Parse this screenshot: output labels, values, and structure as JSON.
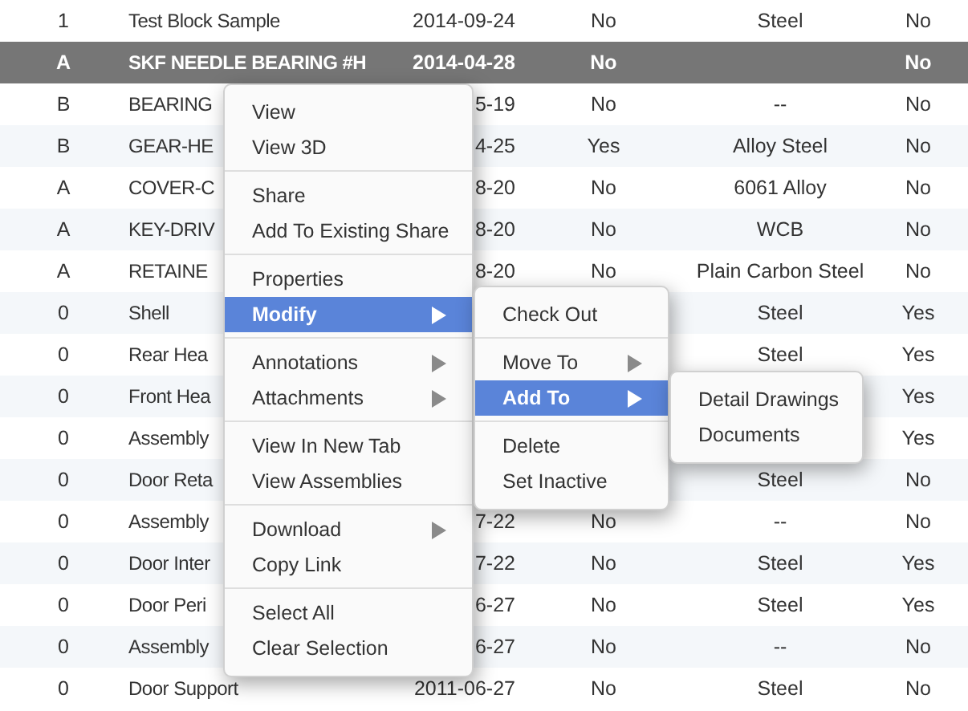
{
  "table": {
    "rows": [
      {
        "selected": false,
        "cells": [
          "1",
          "Test Block Sample",
          "2014-09-24",
          "No",
          "Steel",
          "No"
        ]
      },
      {
        "selected": true,
        "cells": [
          "A",
          "SKF NEEDLE BEARING #H",
          "2014-04-28",
          "No",
          null,
          "No"
        ]
      },
      {
        "selected": false,
        "cells": [
          "B",
          "BEARING",
          "5-19",
          "No",
          "--",
          "No"
        ]
      },
      {
        "selected": false,
        "cells": [
          "B",
          "GEAR-HE",
          "4-25",
          "Yes",
          "Alloy Steel",
          "No"
        ]
      },
      {
        "selected": false,
        "cells": [
          "A",
          "COVER-C",
          "8-20",
          "No",
          "6061 Alloy",
          "No"
        ]
      },
      {
        "selected": false,
        "cells": [
          "A",
          "KEY-DRIV",
          "8-20",
          "No",
          "WCB",
          "No"
        ]
      },
      {
        "selected": false,
        "cells": [
          "A",
          "RETAINE",
          "8-20",
          "No",
          "Plain Carbon Steel",
          "No"
        ]
      },
      {
        "selected": false,
        "cells": [
          "0",
          "Shell",
          null,
          null,
          "Steel",
          "Yes"
        ]
      },
      {
        "selected": false,
        "cells": [
          "0",
          "Rear Hea",
          null,
          null,
          "Steel",
          "Yes"
        ]
      },
      {
        "selected": false,
        "cells": [
          "0",
          "Front Hea",
          null,
          null,
          null,
          "Yes"
        ]
      },
      {
        "selected": false,
        "cells": [
          "0",
          "Assembly",
          null,
          null,
          null,
          "Yes"
        ]
      },
      {
        "selected": false,
        "cells": [
          "0",
          "Door Reta",
          null,
          null,
          "Steel",
          "No"
        ]
      },
      {
        "selected": false,
        "cells": [
          "0",
          "Assembly",
          "7-22",
          "No",
          "--",
          "No"
        ]
      },
      {
        "selected": false,
        "cells": [
          "0",
          "Door Inter",
          "7-22",
          "No",
          "Steel",
          "Yes"
        ]
      },
      {
        "selected": false,
        "cells": [
          "0",
          "Door Peri",
          "6-27",
          "No",
          "Steel",
          "Yes"
        ]
      },
      {
        "selected": false,
        "cells": [
          "0",
          "Assembly",
          "6-27",
          "No",
          "--",
          "No"
        ]
      },
      {
        "selected": false,
        "cells": [
          "0",
          "Door Support",
          "2011-06-27",
          "No",
          "Steel",
          "No"
        ]
      }
    ]
  },
  "context_menu": {
    "groups": [
      [
        {
          "label": "View",
          "submenu": false,
          "selected": false
        },
        {
          "label": "View 3D",
          "submenu": false,
          "selected": false
        }
      ],
      [
        {
          "label": "Share",
          "submenu": false,
          "selected": false
        },
        {
          "label": "Add To Existing Share",
          "submenu": false,
          "selected": false
        }
      ],
      [
        {
          "label": "Properties",
          "submenu": false,
          "selected": false
        },
        {
          "label": "Modify",
          "submenu": true,
          "selected": true
        }
      ],
      [
        {
          "label": "Annotations",
          "submenu": true,
          "selected": false
        },
        {
          "label": "Attachments",
          "submenu": true,
          "selected": false
        }
      ],
      [
        {
          "label": "View In New Tab",
          "submenu": false,
          "selected": false
        },
        {
          "label": "View Assemblies",
          "submenu": false,
          "selected": false
        }
      ],
      [
        {
          "label": "Download",
          "submenu": true,
          "selected": false
        },
        {
          "label": "Copy Link",
          "submenu": false,
          "selected": false
        }
      ],
      [
        {
          "label": "Select All",
          "submenu": false,
          "selected": false
        },
        {
          "label": "Clear Selection",
          "submenu": false,
          "selected": false
        }
      ]
    ]
  },
  "modify_submenu": {
    "groups": [
      [
        {
          "label": "Check Out",
          "submenu": false,
          "selected": false
        }
      ],
      [
        {
          "label": "Move To",
          "submenu": true,
          "selected": false
        },
        {
          "label": "Add To",
          "submenu": true,
          "selected": true
        }
      ],
      [
        {
          "label": "Delete",
          "submenu": false,
          "selected": false
        },
        {
          "label": "Set Inactive",
          "submenu": false,
          "selected": false
        }
      ]
    ]
  },
  "add_to_submenu": {
    "groups": [
      [
        {
          "label": "Detail Drawings",
          "submenu": false,
          "selected": false
        },
        {
          "label": "Documents",
          "submenu": false,
          "selected": false
        }
      ]
    ]
  }
}
